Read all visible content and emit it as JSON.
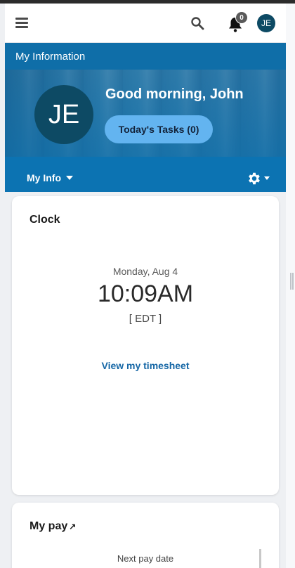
{
  "header": {
    "avatar_initials": "JE",
    "notification_count": "0"
  },
  "hero": {
    "section_title": "My Information",
    "avatar_initials": "JE",
    "greeting": "Good morning, John",
    "tasks_button": "Today's Tasks (0)",
    "myinfo_menu": "My Info"
  },
  "clock": {
    "title": "Clock",
    "date": "Monday, Aug 4",
    "time": "10:09AM",
    "timezone": "[ EDT ]",
    "timesheet_link": "View my timesheet"
  },
  "pay": {
    "title": "My pay",
    "next_pay_label": "Next pay date"
  },
  "colors": {
    "brand_blue": "#0c74b3",
    "avatar_bg": "#0d4a64",
    "tasks_button_bg": "#63b4f0",
    "link_blue": "#1667a6"
  },
  "icons": [
    "menu-icon",
    "search-icon",
    "bell-icon",
    "gear-icon",
    "external-link-icon",
    "chevron-down-icon"
  ]
}
